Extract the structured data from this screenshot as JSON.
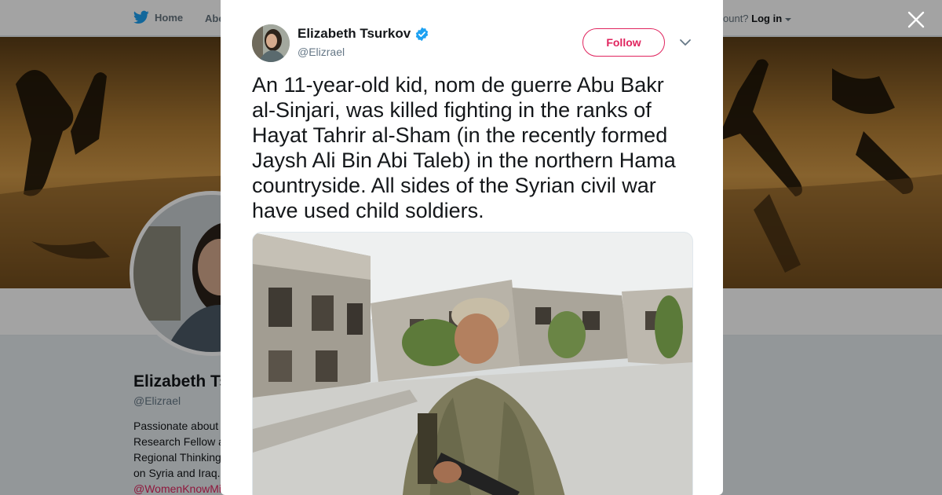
{
  "topbar": {
    "home_label": "Home",
    "about_label": "Abo",
    "account_prompt": "ccount?",
    "login_label": "Log in"
  },
  "profile": {
    "name": "Elizabeth Ts",
    "handle": "@Elizrael",
    "bio_lines": [
      "Passionate about",
      "Research Fellow a",
      "Regional Thinking",
      "on Syria and Iraq."
    ],
    "bio_link": "@WomenKnowMi"
  },
  "tweet": {
    "author_name": "Elizabeth Tsurkov",
    "author_handle": "@Elizrael",
    "verified": true,
    "follow_label": "Follow",
    "text_lines": [
      "An 11-year-old kid, nom de guerre Abu Bakr",
      "al-Sinjari, was killed fighting in the ranks of",
      "Hayat Tahrir al-Sham (in the recently formed",
      "Jaysh Ali Bin Abi Taleb) in the northern Hama",
      "countryside. All sides of the Syrian civil war",
      "have used child soldiers."
    ]
  },
  "colors": {
    "twitter_blue": "#1da1f2",
    "follow_accent": "#e0245e",
    "verified_blue": "#1da1f2"
  },
  "icons": [
    "twitter-bird-icon",
    "caret-down-icon",
    "close-icon",
    "verified-badge-icon",
    "chevron-down-icon"
  ]
}
